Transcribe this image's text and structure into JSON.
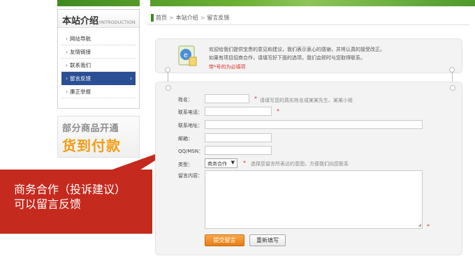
{
  "sidebar": {
    "title": "本站介绍",
    "title_en": "/INTRODUCTION",
    "items": [
      {
        "label": "网站导航"
      },
      {
        "label": "友情链接"
      },
      {
        "label": "联系我们"
      },
      {
        "label": "留言反馈",
        "active": true
      },
      {
        "label": "廉正举报"
      }
    ],
    "promo_line1": "部分商品开通",
    "promo_line2": "货到付款"
  },
  "callout": {
    "line1": "商务合作（投诉建议）",
    "line2": "可以留言反馈"
  },
  "breadcrumb": [
    "首页",
    "本站介绍",
    "留言反馈"
  ],
  "notice": {
    "line1": "欢迎给我们提供宝贵的意见和建议，我们表示衷心的感谢，并将认真的接受改正。",
    "line2": "如果有项目招商合作，请填写好下面的选项，我们会即时与您取得联系。",
    "line3": "带*号的为必填项"
  },
  "form": {
    "name_label": "姓名：",
    "name_hint": "请填写您的真实姓名或某某先生、某某小姐",
    "phone_label": "联系电话：",
    "address_label": "联系地址：",
    "email_label": "邮箱：",
    "qq_label": "QQ/MSN：",
    "type_label": "类型：",
    "type_value": "商务合作",
    "type_hint": "选择您留言所表达的意图，方便我们向您联系",
    "message_label": "留言内容：",
    "required_mark": "*",
    "submit_label": "提交留言",
    "reset_label": "重新填写"
  },
  "colors": {
    "accent_green": "#3f8a1f",
    "active_blue": "#2b4f94",
    "callout_red": "#c52a1f",
    "submit_orange": "#e57d14",
    "required_red": "#d9302b"
  }
}
